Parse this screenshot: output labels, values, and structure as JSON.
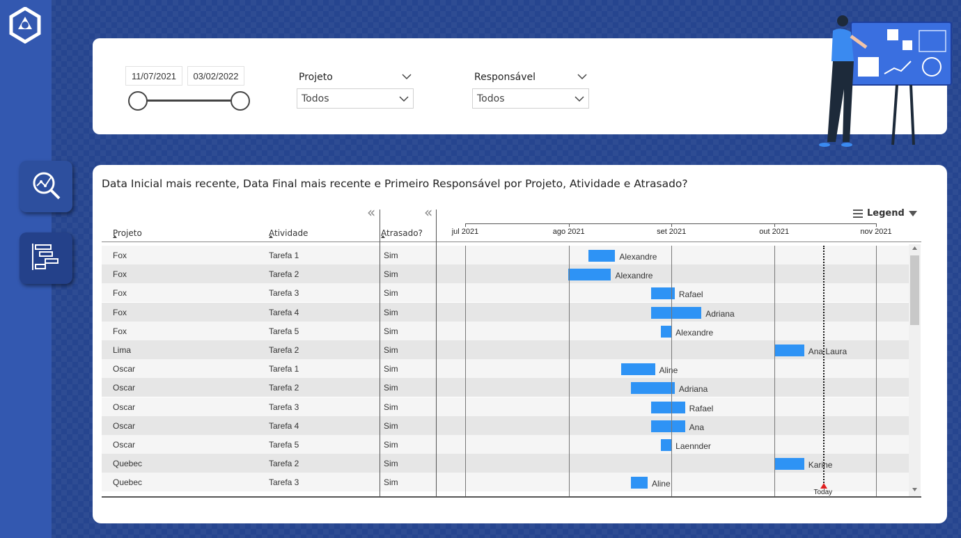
{
  "sidebar": {
    "logo": "logo-icon",
    "nav": [
      {
        "icon": "analytics-search-icon"
      },
      {
        "icon": "gantt-chart-icon"
      }
    ]
  },
  "filters": {
    "date_start": "11/07/2021",
    "date_end": "03/02/2022",
    "projeto": {
      "title": "Projeto",
      "value": "Todos"
    },
    "responsavel": {
      "title": "Responsável",
      "value": "Todos"
    }
  },
  "gantt": {
    "title": "Data Inicial mais recente, Data Final mais recente e Primeiro Responsável por Projeto, Atividade e Atrasado?",
    "columns": {
      "projeto": "Projeto",
      "atividade": "Atividade",
      "atrasado": "Atrasado?"
    },
    "collapse_glyph": "«",
    "legend_label": "Legend",
    "ticks": [
      "jul 2021",
      "ago 2021",
      "set 2021",
      "out 2021",
      "nov 2021"
    ],
    "today_label": "Today",
    "colors": {
      "bar": "#2e93f5",
      "today": "#e02020",
      "row_alt": "#e6e6e6",
      "row": "#f5f5f5"
    },
    "rows": [
      {
        "projeto": "Fox",
        "atividade": "Tarefa 1",
        "atrasado": "Sim",
        "start": 0.3,
        "dur": 0.065,
        "resp": "Alexandre"
      },
      {
        "projeto": "Fox",
        "atividade": "Tarefa 2",
        "atrasado": "Sim",
        "start": 0.25,
        "dur": 0.105,
        "resp": "Alexandre"
      },
      {
        "projeto": "Fox",
        "atividade": "Tarefa 3",
        "atrasado": "Sim",
        "start": 0.452,
        "dur": 0.058,
        "resp": "Rafael"
      },
      {
        "projeto": "Fox",
        "atividade": "Tarefa 4",
        "atrasado": "Sim",
        "start": 0.452,
        "dur": 0.123,
        "resp": "Adriana"
      },
      {
        "projeto": "Fox",
        "atividade": "Tarefa 5",
        "atrasado": "Sim",
        "start": 0.477,
        "dur": 0.025,
        "resp": "Alexandre"
      },
      {
        "projeto": "Lima",
        "atividade": "Tarefa 2",
        "atrasado": "Sim",
        "start": 0.752,
        "dur": 0.073,
        "resp": "Ana Laura"
      },
      {
        "projeto": "Oscar",
        "atividade": "Tarefa 1",
        "atrasado": "Sim",
        "start": 0.38,
        "dur": 0.082,
        "resp": "Aline"
      },
      {
        "projeto": "Oscar",
        "atividade": "Tarefa 2",
        "atrasado": "Sim",
        "start": 0.404,
        "dur": 0.106,
        "resp": "Adriana"
      },
      {
        "projeto": "Oscar",
        "atividade": "Tarefa 3",
        "atrasado": "Sim",
        "start": 0.452,
        "dur": 0.083,
        "resp": "Rafael"
      },
      {
        "projeto": "Oscar",
        "atividade": "Tarefa 4",
        "atrasado": "Sim",
        "start": 0.452,
        "dur": 0.083,
        "resp": "Ana"
      },
      {
        "projeto": "Oscar",
        "atividade": "Tarefa 5",
        "atrasado": "Sim",
        "start": 0.477,
        "dur": 0.025,
        "resp": "Laennder"
      },
      {
        "projeto": "Quebec",
        "atividade": "Tarefa 2",
        "atrasado": "Sim",
        "start": 0.752,
        "dur": 0.073,
        "resp": "Karine"
      },
      {
        "projeto": "Quebec",
        "atividade": "Tarefa 3",
        "atrasado": "Sim",
        "start": 0.404,
        "dur": 0.04,
        "resp": "Aline"
      }
    ]
  }
}
